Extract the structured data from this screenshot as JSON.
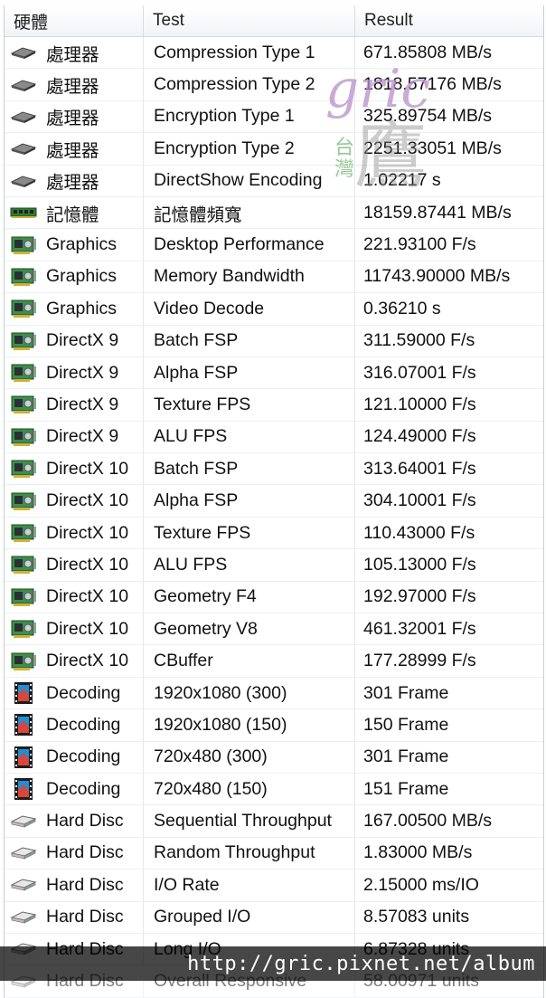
{
  "columns": {
    "hardware": "硬體",
    "test": "Test",
    "result": "Result"
  },
  "rows": [
    {
      "icon": "cpu-icon",
      "hw": "處理器",
      "test": "Compression Type 1",
      "result": "671.85808 MB/s"
    },
    {
      "icon": "cpu-icon",
      "hw": "處理器",
      "test": "Compression Type 2",
      "result": "1818.57176 MB/s"
    },
    {
      "icon": "cpu-icon",
      "hw": "處理器",
      "test": "Encryption Type 1",
      "result": "325.89754 MB/s"
    },
    {
      "icon": "cpu-icon",
      "hw": "處理器",
      "test": "Encryption Type 2",
      "result": "2251.33051 MB/s"
    },
    {
      "icon": "cpu-icon",
      "hw": "處理器",
      "test": "DirectShow Encoding",
      "result": "1.02217 s"
    },
    {
      "icon": "memory-icon",
      "hw": "記憶體",
      "test": "記憶體頻寬",
      "result": "18159.87441 MB/s"
    },
    {
      "icon": "graphics-card-icon",
      "hw": "Graphics",
      "test": "Desktop Performance",
      "result": "221.93100 F/s"
    },
    {
      "icon": "graphics-card-icon",
      "hw": "Graphics",
      "test": "Memory Bandwidth",
      "result": "11743.90000 MB/s"
    },
    {
      "icon": "graphics-card-icon",
      "hw": "Graphics",
      "test": "Video Decode",
      "result": "0.36210 s"
    },
    {
      "icon": "graphics-card-icon",
      "hw": "DirectX 9",
      "test": "Batch FSP",
      "result": "311.59000 F/s"
    },
    {
      "icon": "graphics-card-icon",
      "hw": "DirectX 9",
      "test": "Alpha FSP",
      "result": "316.07001 F/s"
    },
    {
      "icon": "graphics-card-icon",
      "hw": "DirectX 9",
      "test": "Texture FPS",
      "result": "121.10000 F/s"
    },
    {
      "icon": "graphics-card-icon",
      "hw": "DirectX 9",
      "test": "ALU FPS",
      "result": "124.49000 F/s"
    },
    {
      "icon": "graphics-card-icon",
      "hw": "DirectX 10",
      "test": "Batch FSP",
      "result": "313.64001 F/s"
    },
    {
      "icon": "graphics-card-icon",
      "hw": "DirectX 10",
      "test": "Alpha FSP",
      "result": "304.10001 F/s"
    },
    {
      "icon": "graphics-card-icon",
      "hw": "DirectX 10",
      "test": "Texture FPS",
      "result": "110.43000 F/s"
    },
    {
      "icon": "graphics-card-icon",
      "hw": "DirectX 10",
      "test": "ALU FPS",
      "result": "105.13000 F/s"
    },
    {
      "icon": "graphics-card-icon",
      "hw": "DirectX 10",
      "test": "Geometry F4",
      "result": "192.97000 F/s"
    },
    {
      "icon": "graphics-card-icon",
      "hw": "DirectX 10",
      "test": "Geometry V8",
      "result": "461.32001 F/s"
    },
    {
      "icon": "graphics-card-icon",
      "hw": "DirectX 10",
      "test": "CBuffer",
      "result": "177.28999 F/s"
    },
    {
      "icon": "film-icon",
      "hw": "Decoding",
      "test": "1920x1080 (300)",
      "result": "301 Frame"
    },
    {
      "icon": "film-icon",
      "hw": "Decoding",
      "test": "1920x1080 (150)",
      "result": "150 Frame"
    },
    {
      "icon": "film-icon",
      "hw": "Decoding",
      "test": "720x480 (300)",
      "result": "301 Frame"
    },
    {
      "icon": "film-icon",
      "hw": "Decoding",
      "test": "720x480 (150)",
      "result": "151 Frame"
    },
    {
      "icon": "hard-disk-icon",
      "hw": "Hard Disc",
      "test": "Sequential Throughput",
      "result": "167.00500 MB/s"
    },
    {
      "icon": "hard-disk-icon",
      "hw": "Hard Disc",
      "test": "Random Throughput",
      "result": "1.83000 MB/s"
    },
    {
      "icon": "hard-disk-icon",
      "hw": "Hard Disc",
      "test": "I/O Rate",
      "result": "2.15000 ms/IO"
    },
    {
      "icon": "hard-disk-icon",
      "hw": "Hard Disc",
      "test": "Grouped I/O",
      "result": "8.57083 units"
    },
    {
      "icon": "hard-disk-icon",
      "hw": "Hard Disc",
      "test": "Long I/O",
      "result": "6.87328 units"
    },
    {
      "icon": "hard-disk-icon",
      "hw": "Hard Disc",
      "test": "Overall Responsive",
      "result": "58.00971 units"
    }
  ],
  "watermark": {
    "url": "http://gric.pixnet.net/album",
    "logo_text": "gric"
  }
}
